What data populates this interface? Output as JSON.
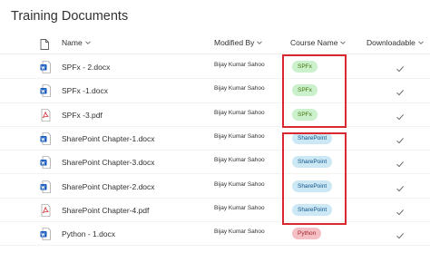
{
  "page": {
    "title": "Training Documents"
  },
  "columns": {
    "name": "Name",
    "modified_by": "Modified By",
    "course_name": "Course Name",
    "downloadable": "Downloadable"
  },
  "rows": [
    {
      "type": "docx",
      "name": "SPFx - 2.docx",
      "modified_by": "Bijay Kumar Sahoo",
      "course": "SPFx",
      "downloadable": true
    },
    {
      "type": "docx",
      "name": "SPFx -1.docx",
      "modified_by": "Bijay Kumar Sahoo",
      "course": "SPFx",
      "downloadable": true
    },
    {
      "type": "pdf",
      "name": "SPFx -3.pdf",
      "modified_by": "Bijay Kumar Sahoo",
      "course": "SPFx",
      "downloadable": true
    },
    {
      "type": "docx",
      "name": "SharePoint Chapter-1.docx",
      "modified_by": "Bijay Kumar Sahoo",
      "course": "SharePoint",
      "downloadable": true
    },
    {
      "type": "docx",
      "name": "SharePoint Chapter-3.docx",
      "modified_by": "Bijay Kumar Sahoo",
      "course": "SharePoint",
      "downloadable": true
    },
    {
      "type": "docx",
      "name": "SharePoint Chapter-2.docx",
      "modified_by": "Bijay Kumar Sahoo",
      "course": "SharePoint",
      "downloadable": true
    },
    {
      "type": "pdf",
      "name": "SharePoint Chapter-4.pdf",
      "modified_by": "Bijay Kumar Sahoo",
      "course": "SharePoint",
      "downloadable": true
    },
    {
      "type": "docx",
      "name": "Python - 1.docx",
      "modified_by": "Bijay Kumar Sahoo",
      "course": "Python",
      "downloadable": true
    }
  ],
  "icons": {
    "document_column": "document-icon",
    "docx": "word-file-icon",
    "pdf": "pdf-file-icon",
    "sort": "chevron-down-icon",
    "downloadable": "checkmark-icon"
  },
  "colors": {
    "SPFx": {
      "bg": "#caf0cc",
      "fg": "#437406"
    },
    "SharePoint": {
      "bg": "#cce8f4",
      "fg": "#0f548c"
    },
    "Python": {
      "bg": "#f4bfc5",
      "fg": "#a4262c"
    },
    "highlight": "#d9282f",
    "word": "#185abd",
    "pdf": "#d13438"
  }
}
